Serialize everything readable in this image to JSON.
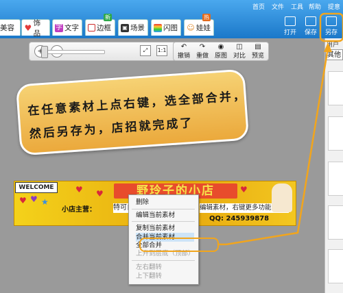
{
  "top_menu": [
    "首页",
    "文件",
    "工具",
    "帮助",
    "提意"
  ],
  "tabs": [
    {
      "label": "美容",
      "icon": "beauty-icon"
    },
    {
      "label": "饰品",
      "icon": "heart-icon",
      "color": "#e23b3b"
    },
    {
      "label": "文字",
      "icon": "text-icon",
      "glyph": "字",
      "color": "#c03bc0"
    },
    {
      "label": "边框",
      "icon": "frame-icon",
      "color": "#cc2b2b",
      "badge": "新"
    },
    {
      "label": "场景",
      "icon": "scene-icon",
      "color": "#333333"
    },
    {
      "label": "闪图",
      "icon": "flash-icon",
      "color": "#7a3fb0"
    },
    {
      "label": "娃娃",
      "icon": "doll-icon",
      "color": "#e08a2a",
      "badge": "热"
    }
  ],
  "right_buttons": [
    {
      "label": "打开",
      "icon": "open-folder-icon"
    },
    {
      "label": "保存",
      "icon": "save-icon"
    },
    {
      "label": "另存",
      "icon": "save-as-icon"
    }
  ],
  "toolbar": {
    "zoom_in": "+",
    "zoom_out": "−",
    "undo": "撤销",
    "redo": "重做",
    "original": "原图",
    "compare": "对比",
    "preview": "预览"
  },
  "right_panel": {
    "tab": "用户",
    "select": "其他"
  },
  "instruction": {
    "line1": "在任意素材上点右键，选全部合并，",
    "line2": "然后另存为，店招就完成了"
  },
  "banner": {
    "welcome": "WELCOME",
    "title": "野玲子的小店",
    "owner": "小店主营：",
    "text_snippet": "特可自",
    "note": "编辑素材，右键更多功能",
    "qq": "QQ: 245939878"
  },
  "context_menu": {
    "items": [
      {
        "label": "删除",
        "enabled": true
      },
      {
        "label": "编辑当前素材",
        "enabled": true
      },
      {
        "label": "复制当前素材",
        "enabled": true
      },
      {
        "label": "合并当前素材",
        "enabled": true
      },
      {
        "label": "全部合并",
        "enabled": true,
        "highlighted": true
      },
      {
        "label": "上升到层底（顶部）",
        "enabled": false
      },
      {
        "label": "左右翻转",
        "enabled": false
      },
      {
        "label": "上下翻转",
        "enabled": false
      }
    ]
  },
  "colors": {
    "header_blue": "#1b78c9",
    "highlight_orange": "#f2a51c",
    "note_bg": "#f0b84a",
    "banner_yellow": "#f0c21a"
  }
}
